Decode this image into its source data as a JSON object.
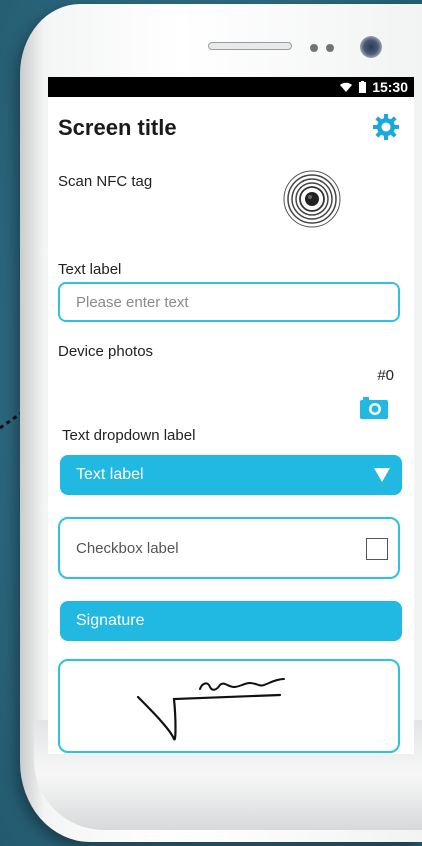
{
  "status_bar": {
    "time": "15:30",
    "wifi_icon": "wifi-icon",
    "battery_icon": "battery-icon"
  },
  "header": {
    "title": "Screen title",
    "settings_icon": "gear-icon"
  },
  "nfc": {
    "label": "Scan NFC tag",
    "icon": "nfc-icon"
  },
  "text_field": {
    "label": "Text label",
    "placeholder": "Please enter text"
  },
  "photos": {
    "label": "Device photos",
    "count": "#0",
    "icon": "camera-icon"
  },
  "dropdown": {
    "label": "Text dropdown label",
    "selected": "Text label"
  },
  "checkbox": {
    "label": "Checkbox label",
    "checked": false
  },
  "signature": {
    "button_label": "Signature"
  },
  "colors": {
    "accent": "#21b8e2",
    "border": "#2ec1e3",
    "background": "#2f6b82"
  }
}
